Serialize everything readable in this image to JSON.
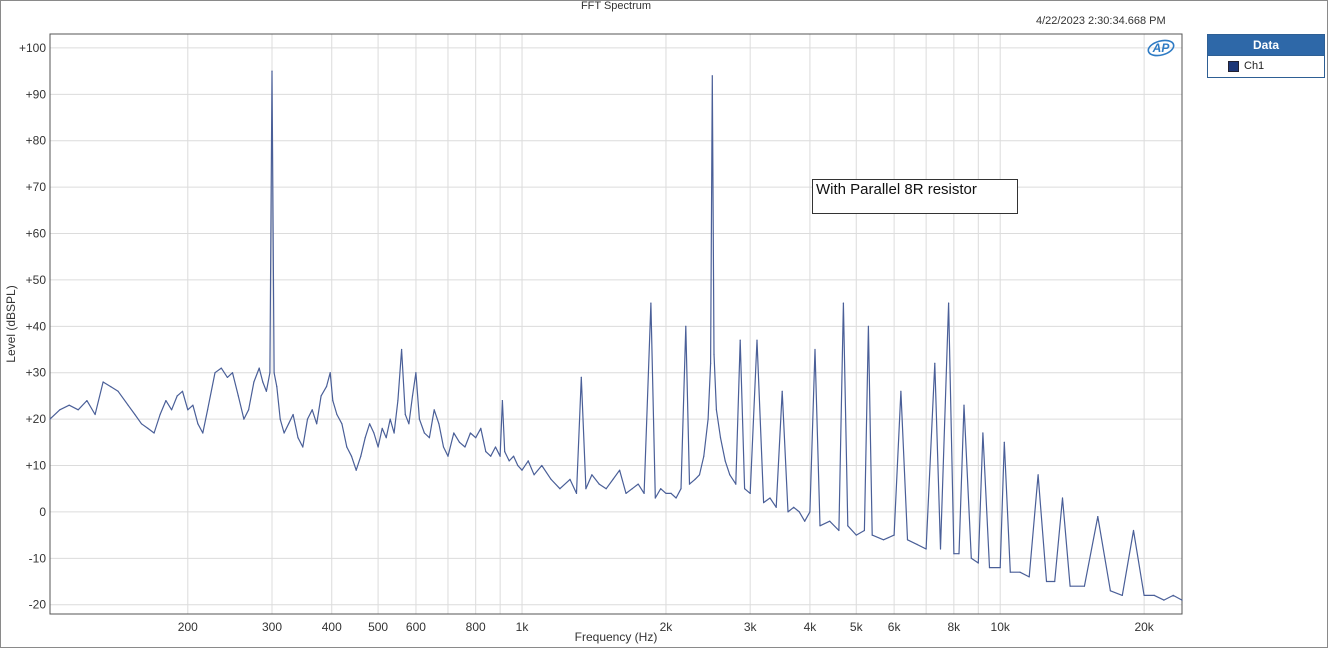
{
  "colors": {
    "series": "#4a5f98",
    "grid": "#dcdcdc",
    "legend_header": "#2e68a8",
    "legend_swatch": "#1d3778"
  },
  "chart_data": {
    "type": "line",
    "title": "FFT Spectrum",
    "timestamp": "4/22/2023 2:30:34.668 PM",
    "xlabel": "Frequency (Hz)",
    "ylabel": "Level (dBSPL)",
    "x_scale": "log",
    "xlim": [
      103,
      24000
    ],
    "ylim": [
      -22,
      103
    ],
    "grid": true,
    "legend_position": "right-outside",
    "legend_title": "Data",
    "annotation": "With Parallel 8R resistor",
    "x_ticks": [
      {
        "value": 200,
        "label": "200"
      },
      {
        "value": 300,
        "label": "300"
      },
      {
        "value": 400,
        "label": "400"
      },
      {
        "value": 500,
        "label": "500"
      },
      {
        "value": 600,
        "label": "600"
      },
      {
        "value": 800,
        "label": "800"
      },
      {
        "value": 1000,
        "label": "1k"
      },
      {
        "value": 2000,
        "label": "2k"
      },
      {
        "value": 3000,
        "label": "3k"
      },
      {
        "value": 4000,
        "label": "4k"
      },
      {
        "value": 5000,
        "label": "5k"
      },
      {
        "value": 6000,
        "label": "6k"
      },
      {
        "value": 8000,
        "label": "8k"
      },
      {
        "value": 10000,
        "label": "10k"
      },
      {
        "value": 20000,
        "label": "20k"
      }
    ],
    "y_ticks": [
      {
        "value": 100,
        "label": "+100"
      },
      {
        "value": 90,
        "label": "+90"
      },
      {
        "value": 80,
        "label": "+80"
      },
      {
        "value": 70,
        "label": "+70"
      },
      {
        "value": 60,
        "label": "+60"
      },
      {
        "value": 50,
        "label": "+50"
      },
      {
        "value": 40,
        "label": "+40"
      },
      {
        "value": 30,
        "label": "+30"
      },
      {
        "value": 20,
        "label": "+20"
      },
      {
        "value": 10,
        "label": "+10"
      },
      {
        "value": 0,
        "label": "0"
      },
      {
        "value": -10,
        "label": "-10"
      },
      {
        "value": -20,
        "label": "-20"
      }
    ],
    "series": [
      {
        "name": "Ch1",
        "points": [
          [
            103,
            20
          ],
          [
            108,
            22
          ],
          [
            113,
            23
          ],
          [
            118,
            22
          ],
          [
            123,
            24
          ],
          [
            128,
            21
          ],
          [
            133,
            28
          ],
          [
            138,
            27
          ],
          [
            143,
            26
          ],
          [
            150,
            23
          ],
          [
            155,
            21
          ],
          [
            160,
            19
          ],
          [
            165,
            18
          ],
          [
            170,
            17
          ],
          [
            175,
            21
          ],
          [
            180,
            24
          ],
          [
            185,
            22
          ],
          [
            190,
            25
          ],
          [
            195,
            26
          ],
          [
            200,
            22
          ],
          [
            205,
            23
          ],
          [
            210,
            19
          ],
          [
            215,
            17
          ],
          [
            220,
            22
          ],
          [
            228,
            30
          ],
          [
            235,
            31
          ],
          [
            242,
            29
          ],
          [
            248,
            30
          ],
          [
            255,
            25
          ],
          [
            262,
            20
          ],
          [
            268,
            22
          ],
          [
            275,
            28
          ],
          [
            282,
            31
          ],
          [
            287,
            28
          ],
          [
            292,
            26
          ],
          [
            297,
            30
          ],
          [
            300,
            95
          ],
          [
            303,
            30
          ],
          [
            307,
            27
          ],
          [
            312,
            20
          ],
          [
            318,
            17
          ],
          [
            325,
            19
          ],
          [
            332,
            21
          ],
          [
            340,
            16
          ],
          [
            348,
            14
          ],
          [
            356,
            20
          ],
          [
            364,
            22
          ],
          [
            372,
            19
          ],
          [
            380,
            25
          ],
          [
            390,
            27
          ],
          [
            397,
            30
          ],
          [
            402,
            24
          ],
          [
            410,
            21
          ],
          [
            420,
            19
          ],
          [
            430,
            14
          ],
          [
            440,
            12
          ],
          [
            450,
            9
          ],
          [
            460,
            12
          ],
          [
            470,
            16
          ],
          [
            480,
            19
          ],
          [
            490,
            17
          ],
          [
            500,
            14
          ],
          [
            510,
            18
          ],
          [
            520,
            16
          ],
          [
            530,
            20
          ],
          [
            540,
            17
          ],
          [
            550,
            24
          ],
          [
            560,
            35
          ],
          [
            570,
            21
          ],
          [
            580,
            19
          ],
          [
            590,
            25
          ],
          [
            600,
            30
          ],
          [
            610,
            20
          ],
          [
            625,
            17
          ],
          [
            640,
            16
          ],
          [
            655,
            22
          ],
          [
            670,
            19
          ],
          [
            685,
            14
          ],
          [
            700,
            12
          ],
          [
            720,
            17
          ],
          [
            740,
            15
          ],
          [
            760,
            14
          ],
          [
            780,
            17
          ],
          [
            800,
            16
          ],
          [
            820,
            18
          ],
          [
            840,
            13
          ],
          [
            860,
            12
          ],
          [
            880,
            14
          ],
          [
            900,
            12
          ],
          [
            910,
            24
          ],
          [
            920,
            13
          ],
          [
            940,
            11
          ],
          [
            960,
            12
          ],
          [
            980,
            10
          ],
          [
            1000,
            9
          ],
          [
            1030,
            11
          ],
          [
            1060,
            8
          ],
          [
            1100,
            10
          ],
          [
            1150,
            7
          ],
          [
            1200,
            5
          ],
          [
            1260,
            7
          ],
          [
            1300,
            4
          ],
          [
            1330,
            29
          ],
          [
            1360,
            5
          ],
          [
            1400,
            8
          ],
          [
            1450,
            6
          ],
          [
            1500,
            5
          ],
          [
            1550,
            7
          ],
          [
            1600,
            9
          ],
          [
            1650,
            4
          ],
          [
            1700,
            5
          ],
          [
            1750,
            6
          ],
          [
            1800,
            4
          ],
          [
            1860,
            45
          ],
          [
            1900,
            3
          ],
          [
            1950,
            5
          ],
          [
            2000,
            4
          ],
          [
            2050,
            4
          ],
          [
            2100,
            3
          ],
          [
            2150,
            5
          ],
          [
            2200,
            40
          ],
          [
            2240,
            6
          ],
          [
            2300,
            7
          ],
          [
            2350,
            8
          ],
          [
            2400,
            12
          ],
          [
            2450,
            20
          ],
          [
            2480,
            32
          ],
          [
            2500,
            94
          ],
          [
            2520,
            34
          ],
          [
            2550,
            22
          ],
          [
            2600,
            16
          ],
          [
            2660,
            11
          ],
          [
            2720,
            8
          ],
          [
            2800,
            6
          ],
          [
            2860,
            37
          ],
          [
            2920,
            5
          ],
          [
            3000,
            4
          ],
          [
            3100,
            37
          ],
          [
            3200,
            2
          ],
          [
            3300,
            3
          ],
          [
            3400,
            1
          ],
          [
            3500,
            26
          ],
          [
            3600,
            0
          ],
          [
            3700,
            1
          ],
          [
            3800,
            0
          ],
          [
            3900,
            -2
          ],
          [
            4000,
            0
          ],
          [
            4100,
            35
          ],
          [
            4200,
            -3
          ],
          [
            4400,
            -2
          ],
          [
            4600,
            -4
          ],
          [
            4700,
            45
          ],
          [
            4800,
            -3
          ],
          [
            5000,
            -5
          ],
          [
            5200,
            -4
          ],
          [
            5300,
            40
          ],
          [
            5400,
            -5
          ],
          [
            5700,
            -6
          ],
          [
            6000,
            -5
          ],
          [
            6200,
            26
          ],
          [
            6400,
            -6
          ],
          [
            6700,
            -7
          ],
          [
            7000,
            -8
          ],
          [
            7300,
            32
          ],
          [
            7500,
            -8
          ],
          [
            7800,
            45
          ],
          [
            8000,
            -9
          ],
          [
            8200,
            -9
          ],
          [
            8400,
            23
          ],
          [
            8700,
            -10
          ],
          [
            9000,
            -11
          ],
          [
            9200,
            17
          ],
          [
            9500,
            -12
          ],
          [
            10000,
            -12
          ],
          [
            10200,
            15
          ],
          [
            10500,
            -13
          ],
          [
            11000,
            -13
          ],
          [
            11500,
            -14
          ],
          [
            12000,
            8
          ],
          [
            12500,
            -15
          ],
          [
            13000,
            -15
          ],
          [
            13500,
            3
          ],
          [
            14000,
            -16
          ],
          [
            15000,
            -16
          ],
          [
            16000,
            -1
          ],
          [
            17000,
            -17
          ],
          [
            18000,
            -18
          ],
          [
            19000,
            -4
          ],
          [
            20000,
            -18
          ],
          [
            21000,
            -18
          ],
          [
            22000,
            -19
          ],
          [
            23000,
            -18
          ],
          [
            24000,
            -19
          ]
        ]
      }
    ]
  }
}
